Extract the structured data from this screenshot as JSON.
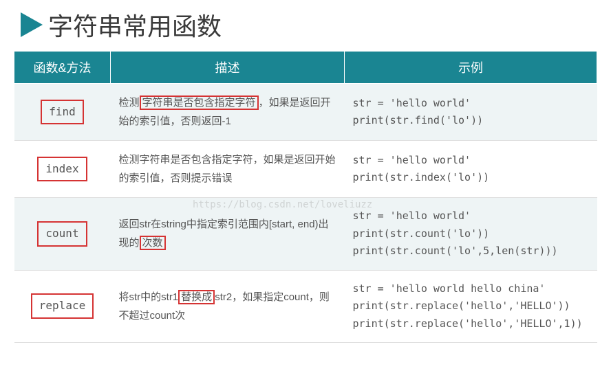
{
  "title": "字符串常用函数",
  "headers": {
    "col1": "函数&方法",
    "col2": "描述",
    "col3": "示例"
  },
  "rows": [
    {
      "fn": "find",
      "desc_pre": "检测",
      "desc_hl": "字符串是否包含指定字符",
      "desc_post": "，如果是返回开始的索引值，否则返回-1",
      "code1": "str = 'hello world'",
      "code2": "print(str.find('lo'))",
      "code3": ""
    },
    {
      "fn": "index",
      "desc_pre": "检测字符串是否包含指定字符，如果是返回开始的索引值，否则提示错误",
      "desc_hl": "",
      "desc_post": "",
      "code1": "str = 'hello world'",
      "code2": "print(str.index('lo'))",
      "code3": ""
    },
    {
      "fn": "count",
      "desc_pre": "返回str在string中指定索引范围内[start, end)出现的",
      "desc_hl": "次数",
      "desc_post": "",
      "code1": "str = 'hello world'",
      "code2": "print(str.count('lo'))",
      "code3": "print(str.count('lo',5,len(str)))"
    },
    {
      "fn": "replace",
      "desc_pre": "将str中的str1",
      "desc_hl": "替换成",
      "desc_post": "str2，如果指定count，则不超过count次",
      "code1": "str = 'hello world hello china'",
      "code2": "print(str.replace('hello','HELLO'))",
      "code3": "print(str.replace('hello','HELLO',1))"
    }
  ],
  "watermark": "https://blog.csdn.net/loveliuzz"
}
